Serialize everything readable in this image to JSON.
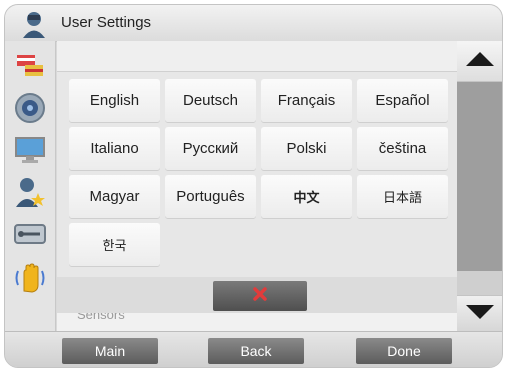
{
  "title": "User Settings",
  "languages": [
    {
      "label": "English",
      "id": "english"
    },
    {
      "label": "Deutsch",
      "id": "deutsch"
    },
    {
      "label": "Français",
      "id": "francais"
    },
    {
      "label": "Español",
      "id": "espanol"
    },
    {
      "label": "Italiano",
      "id": "italiano"
    },
    {
      "label": "Русский",
      "id": "russian"
    },
    {
      "label": "Polski",
      "id": "polski"
    },
    {
      "label": "čeština",
      "id": "cestina"
    },
    {
      "label": "Magyar",
      "id": "magyar"
    },
    {
      "label": "Português",
      "id": "portugues"
    },
    {
      "label": "中文",
      "id": "chinese"
    },
    {
      "label": "日本語",
      "id": "japanese"
    },
    {
      "label": "한국",
      "id": "korean"
    }
  ],
  "behind_list_item": "Sensors",
  "sidebar": {
    "icons": [
      "user-icon",
      "flags-icon",
      "speaker-icon",
      "monitor-icon",
      "user-star-icon",
      "tools-icon",
      "hand-icon"
    ]
  },
  "bottom_nav": {
    "main_label": "Main",
    "back_label": "Back",
    "done_label": "Done"
  },
  "colors": {
    "cancel_x": "#e23b3b",
    "button_grey": "#6a6a6a"
  }
}
